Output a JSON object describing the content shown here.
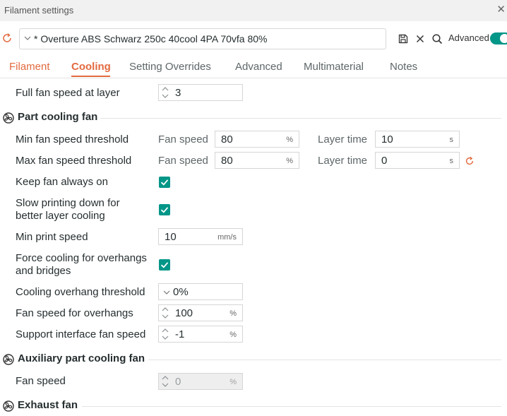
{
  "window": {
    "title": "Filament settings",
    "close_glyph": "✕"
  },
  "toolbar": {
    "preset_name": "* Overture ABS Schwarz 250c 40cool 4PA 70vfa 80%",
    "advanced_label": "Advanced",
    "advanced_on": true,
    "accent_color": "#009688"
  },
  "tabs": [
    {
      "label": "Filament"
    },
    {
      "label": "Cooling",
      "active": true
    },
    {
      "label": "Setting Overrides"
    },
    {
      "label": "Advanced"
    },
    {
      "label": "Multimaterial"
    },
    {
      "label": "Notes"
    }
  ],
  "cooling": {
    "full_fan_speed_layer": {
      "label": "Full fan speed at layer",
      "value": "3"
    },
    "part_cooling": {
      "title": "Part cooling fan",
      "min_threshold": {
        "label": "Min fan speed threshold",
        "fan_label": "Fan speed",
        "fan_value": "80",
        "fan_unit": "%",
        "time_label": "Layer time",
        "time_value": "10",
        "time_unit": "s"
      },
      "max_threshold": {
        "label": "Max fan speed threshold",
        "fan_label": "Fan speed",
        "fan_value": "80",
        "fan_unit": "%",
        "time_label": "Layer time",
        "time_value": "0",
        "time_unit": "s"
      },
      "keep_fan_on": {
        "label": "Keep fan always on",
        "checked": true
      },
      "slow_down": {
        "label": "Slow printing down for better layer cooling",
        "checked": true
      },
      "min_print_speed": {
        "label": "Min print speed",
        "value": "10",
        "unit": "mm/s"
      },
      "force_cooling": {
        "label": "Force cooling for overhangs and bridges",
        "checked": true
      },
      "overhang_threshold": {
        "label": "Cooling overhang threshold",
        "value": "0%"
      },
      "overhang_fan_speed": {
        "label": "Fan speed for overhangs",
        "value": "100",
        "unit": "%"
      },
      "support_interface_fan": {
        "label": "Support interface fan speed",
        "value": "-1",
        "unit": "%"
      }
    },
    "aux_fan": {
      "title": "Auxiliary part cooling fan",
      "fan_speed": {
        "label": "Fan speed",
        "value": "0",
        "unit": "%"
      }
    },
    "exhaust_fan": {
      "title": "Exhaust fan"
    }
  }
}
